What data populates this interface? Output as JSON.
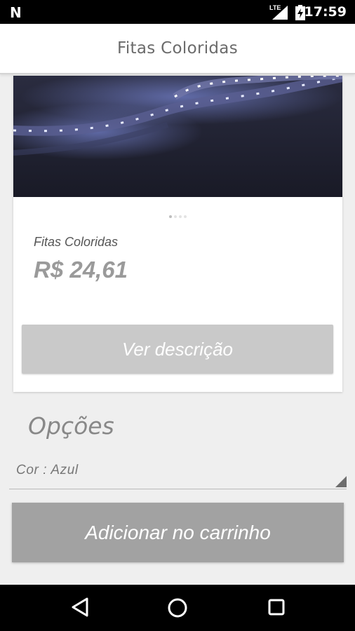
{
  "status_bar": {
    "network": "LTE",
    "time": "17:59",
    "icons": [
      "notification-n-icon",
      "lte-signal-icon",
      "battery-charging-icon"
    ]
  },
  "app_bar": {
    "title": "Fitas Coloridas"
  },
  "product": {
    "image_icon": "led-strip-photo",
    "carousel_page": 1,
    "carousel_total": 4,
    "name": "Fitas Coloridas",
    "price": "R$ 24,61",
    "description_button": "Ver descrição"
  },
  "options": {
    "title": "Opções",
    "color_select": {
      "selected": "Cor : Azul"
    }
  },
  "cart_button": "Adicionar no carrinho",
  "nav_bar": {
    "icons": [
      "back-icon",
      "home-icon",
      "recents-icon"
    ]
  },
  "colors": {
    "description_button_bg": "#c9c9c9",
    "cart_button_bg": "#a2a2a2",
    "page_bg": "#efefef"
  }
}
